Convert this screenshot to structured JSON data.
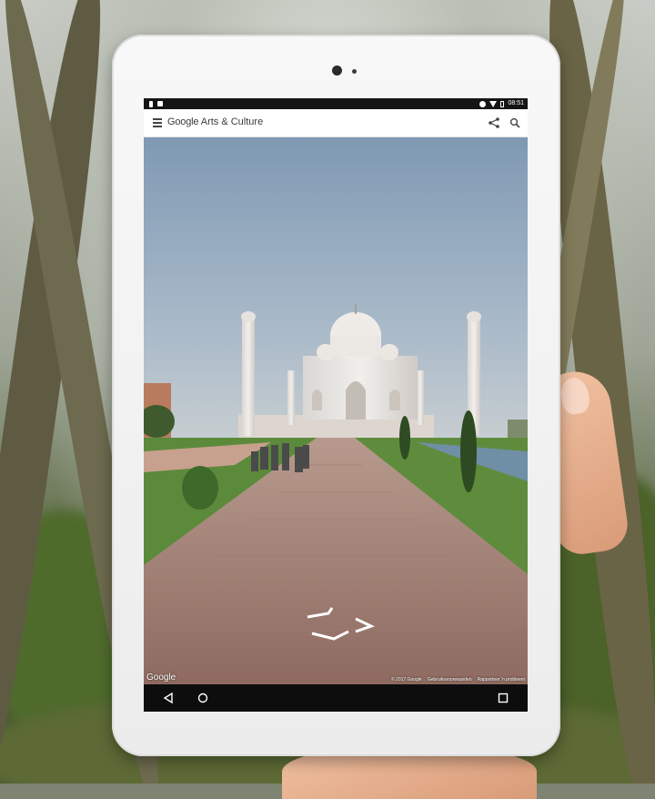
{
  "status_bar": {
    "time": "08:51"
  },
  "app_bar": {
    "title_brand": "Google",
    "title_product": "Arts & Culture"
  },
  "street_view": {
    "watermark": "Google",
    "credits": [
      "© 2017 Google",
      "Gebruiksvoorwaarden",
      "Rapporteer 'n probleem"
    ]
  },
  "icons": {
    "menu": "menu-icon",
    "share": "share-icon",
    "search": "search-icon",
    "back": "back-icon",
    "home": "home-icon",
    "recent": "recent-apps-icon",
    "navigate": "street-view-arrows-icon"
  },
  "colors": {
    "app_bar": "#ffffff",
    "status_bar": "#151515",
    "nav_bar": "#0d0d0d"
  }
}
